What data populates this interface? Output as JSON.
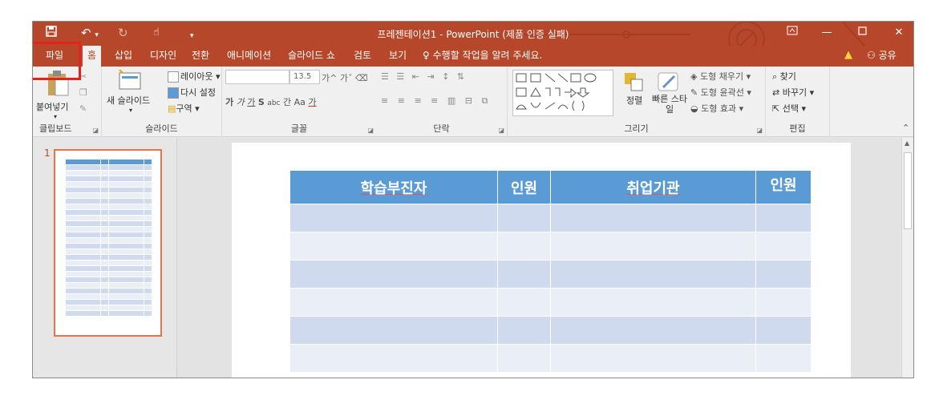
{
  "window": {
    "title": "프레젠테이션1 - PowerPoint (제품 인증 실패)",
    "quick_access": [
      "save-icon",
      "undo-icon",
      "redo-icon",
      "touch-mode-icon",
      "customize-icon"
    ],
    "controls": [
      "ribbon-display-icon",
      "minimize-icon",
      "maximize-icon",
      "close-icon"
    ]
  },
  "tabs": [
    "파일",
    "홈",
    "삽입",
    "디자인",
    "전환",
    "애니메이션",
    "슬라이드 쇼",
    "검토",
    "보기"
  ],
  "active_tab": "홈",
  "tell_me": "수행할 작업을 알려 주세요.",
  "share_label": "공유",
  "ribbon": {
    "clipboard": {
      "label": "클립보드",
      "paste": "붙여넣기"
    },
    "slides": {
      "label": "슬라이드",
      "new_slide": "새 슬라이드",
      "layout": "레이아웃",
      "reset": "다시 설정",
      "section": "구역"
    },
    "font": {
      "label": "글꼴",
      "font_name": "",
      "font_size": "13.5",
      "bold": "가",
      "italic": "가",
      "underline": "가",
      "strike": "S",
      "spacing": "간",
      "case": "Aa",
      "color": "가"
    },
    "paragraph": {
      "label": "단락"
    },
    "drawing": {
      "label": "그리기",
      "arrange": "정렬",
      "quick_styles": "빠른 스타일",
      "fill": "도형 채우기",
      "outline": "도형 윤곽선",
      "effects": "도형 효과"
    },
    "editing": {
      "label": "편집",
      "find": "찾기",
      "replace": "바꾸기",
      "select": "선택"
    }
  },
  "slide_panel": {
    "slide_number": "1"
  },
  "slide_table": {
    "headers": [
      "학습부진자",
      "인원",
      "취업기관",
      "인원"
    ],
    "data_rows": 6
  },
  "colors": {
    "accent": "#b7472a",
    "table_header": "#5b9bd5",
    "row_odd": "#cfdaee",
    "row_even": "#e9eef7",
    "highlight": "#e8221a"
  }
}
